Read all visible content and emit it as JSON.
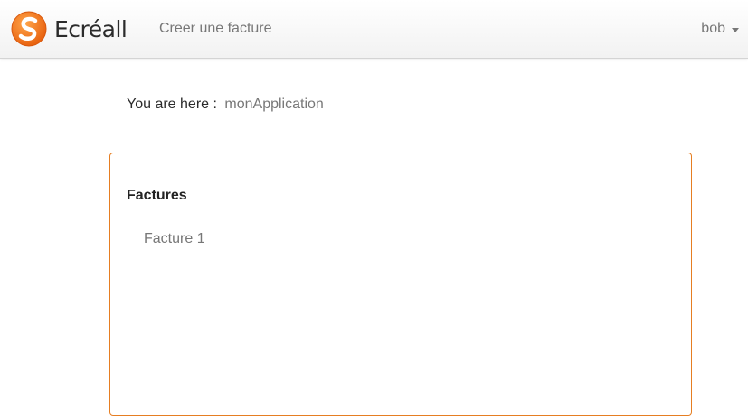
{
  "navbar": {
    "brand_name": "Ecréall",
    "logo_icon": "ecreall-logo-icon",
    "nav_link": "Creer une facture",
    "user_label": "bob",
    "user_caret_icon": "caret-down-icon"
  },
  "breadcrumb": {
    "label": "You are here :",
    "link": "monApplication"
  },
  "panel": {
    "title": "Factures",
    "items": [
      {
        "label": "Facture 1"
      }
    ]
  },
  "colors": {
    "accent": "#e67e22",
    "logo_orange": "#f07b1f",
    "muted_text": "#777777",
    "navbar_border": "#d4d4d4"
  }
}
